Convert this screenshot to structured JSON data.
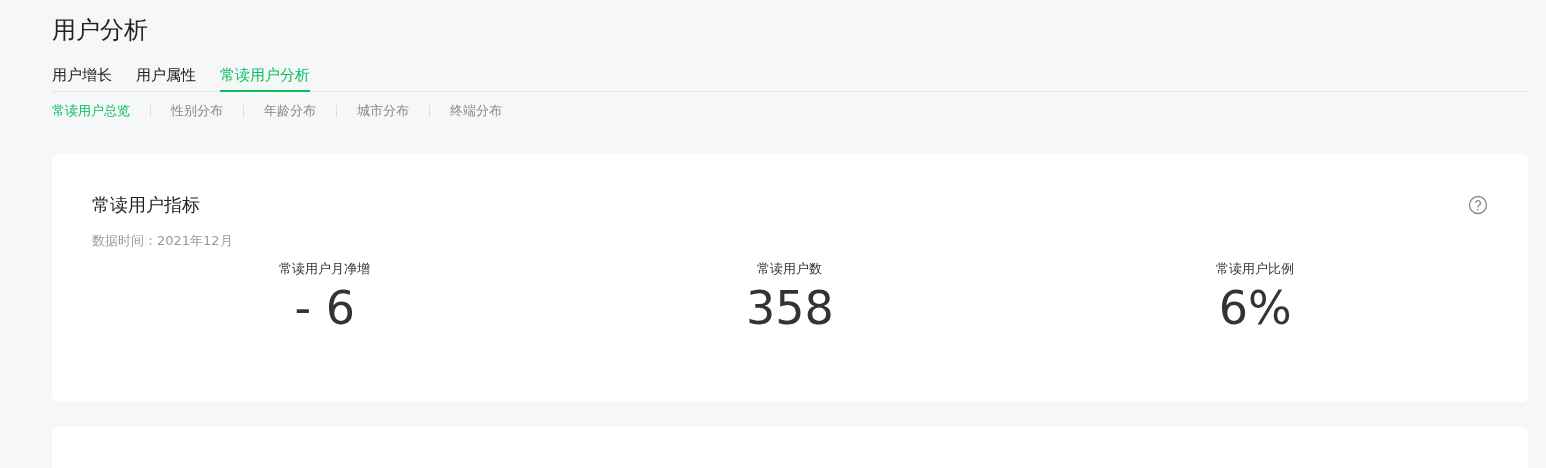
{
  "page_title": "用户分析",
  "tabs": [
    {
      "label": "用户增长",
      "selected": false
    },
    {
      "label": "用户属性",
      "selected": false
    },
    {
      "label": "常读用户分析",
      "selected": true
    }
  ],
  "sub_tabs": [
    {
      "label": "常读用户总览",
      "selected": true
    },
    {
      "label": "性别分布",
      "selected": false
    },
    {
      "label": "年龄分布",
      "selected": false
    },
    {
      "label": "城市分布",
      "selected": false
    },
    {
      "label": "终端分布",
      "selected": false
    }
  ],
  "card": {
    "title": "常读用户指标",
    "data_time": "数据时间：2021年12月",
    "metrics": [
      {
        "label": "常读用户月净增",
        "value": "- 6"
      },
      {
        "label": "常读用户数",
        "value": "358"
      },
      {
        "label": "常读用户比例",
        "value": "6%"
      }
    ]
  }
}
